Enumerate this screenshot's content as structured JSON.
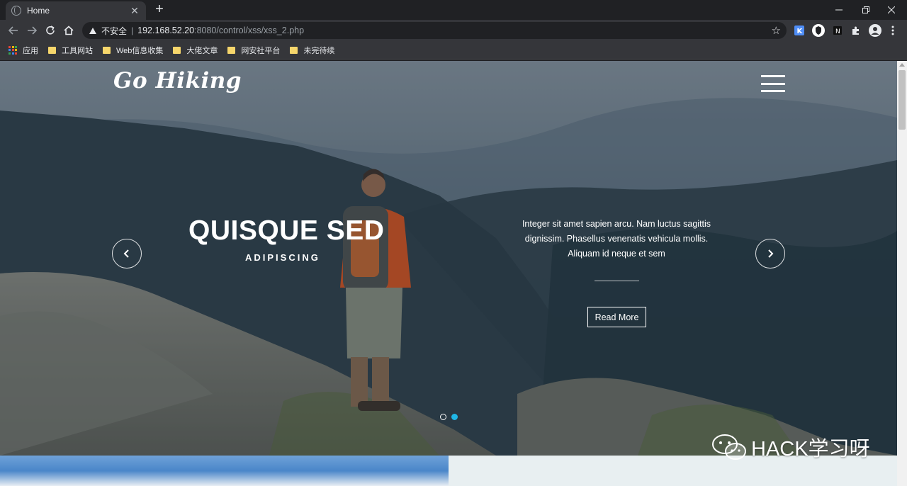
{
  "browser": {
    "tab_title": "Home",
    "new_tab_label": "+",
    "url_warning_label": "不安全",
    "url_host": "192.168.52.20",
    "url_rest": ":8080/control/xss/xss_2.php"
  },
  "bookmarks": [
    {
      "label": "应用",
      "icon": "apps-grid-icon"
    },
    {
      "label": "工具网站",
      "icon": "folder-icon"
    },
    {
      "label": "Web信息收集",
      "icon": "folder-icon"
    },
    {
      "label": "大佬文章",
      "icon": "folder-icon"
    },
    {
      "label": "网安社平台",
      "icon": "folder-icon"
    },
    {
      "label": "未完待续",
      "icon": "folder-icon"
    }
  ],
  "site": {
    "logo": "Go Hiking"
  },
  "slide": {
    "title": "QUISQUE SED",
    "subtitle": "ADIPISCING",
    "text": "Integer sit amet sapien arcu. Nam luctus sagittis dignissim. Phasellus venenatis vehicula mollis. Aliquam id neque et sem",
    "button": "Read More",
    "active_dot": 2,
    "dot_count": 2
  },
  "watermark": "HACK学习呀",
  "colors": {
    "accent_dot": "#1fb6e6",
    "chrome_dark": "#202124",
    "chrome_mid": "#35363a"
  }
}
